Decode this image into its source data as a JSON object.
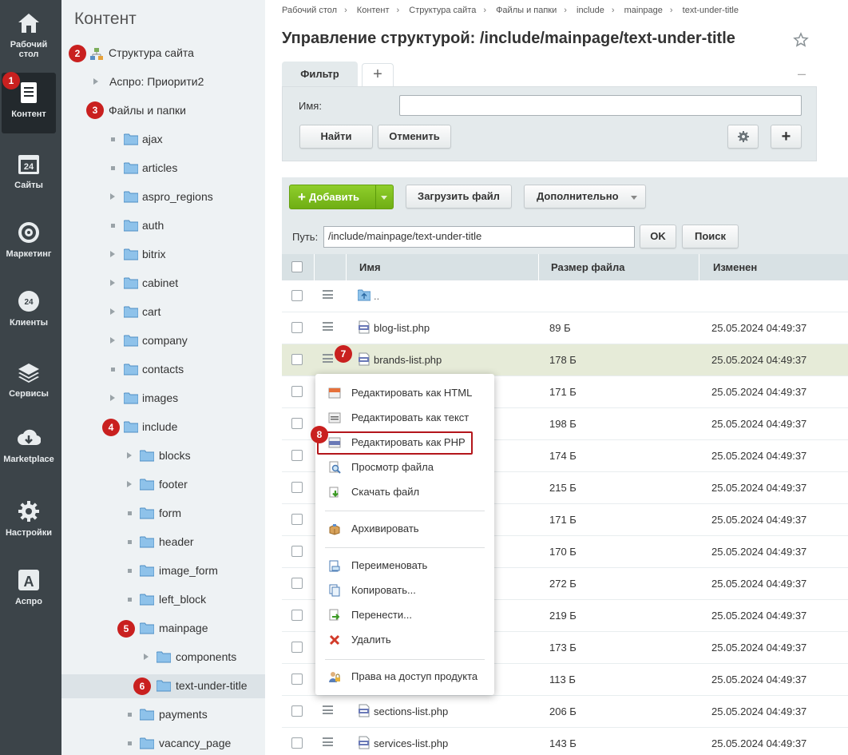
{
  "nav": {
    "items": [
      {
        "label": "Рабочий стол",
        "icon": "desktop-icon"
      },
      {
        "label": "Контент",
        "icon": "document-icon"
      },
      {
        "label": "Сайты",
        "icon": "calendar-24-icon"
      },
      {
        "label": "Маркетинг",
        "icon": "target-icon"
      },
      {
        "label": "Клиенты",
        "icon": "clients-24-icon"
      },
      {
        "label": "Сервисы",
        "icon": "layers-icon"
      },
      {
        "label": "Marketplace",
        "icon": "cloud-download-icon"
      },
      {
        "label": "Настройки",
        "icon": "gear-icon"
      },
      {
        "label": "Аспро",
        "icon": "letter-a-icon"
      }
    ]
  },
  "menu": {
    "title": "Контент",
    "tree": [
      {
        "label": "Структура сайта"
      },
      {
        "label": "Аспро: Приорити2"
      },
      {
        "label": "Файлы и папки"
      },
      {
        "label": "ajax"
      },
      {
        "label": "articles"
      },
      {
        "label": "aspro_regions"
      },
      {
        "label": "auth"
      },
      {
        "label": "bitrix"
      },
      {
        "label": "cabinet"
      },
      {
        "label": "cart"
      },
      {
        "label": "company"
      },
      {
        "label": "contacts"
      },
      {
        "label": "images"
      },
      {
        "label": "include"
      },
      {
        "label": "blocks"
      },
      {
        "label": "footer"
      },
      {
        "label": "form"
      },
      {
        "label": "header"
      },
      {
        "label": "image_form"
      },
      {
        "label": "left_block"
      },
      {
        "label": "mainpage"
      },
      {
        "label": "components"
      },
      {
        "label": "text-under-title"
      },
      {
        "label": "payments"
      },
      {
        "label": "vacancy_page"
      }
    ]
  },
  "badges": [
    "1",
    "2",
    "3",
    "4",
    "5",
    "6",
    "7",
    "8"
  ],
  "breadcrumb": [
    "Рабочий стол",
    "Контент",
    "Структура сайта",
    "Файлы и папки",
    "include",
    "mainpage",
    "text-under-title"
  ],
  "page": {
    "title": "Управление структурой: /include/mainpage/text-under-title"
  },
  "filter": {
    "tab_label": "Фильтр",
    "add_tab": "+",
    "minimize": "–",
    "name_label": "Имя:",
    "name_value": "",
    "find_label": "Найти",
    "cancel_label": "Отменить",
    "add_label": "+"
  },
  "toolbar": {
    "add_label": "Добавить",
    "upload_label": "Загрузить файл",
    "more_label": "Дополнительно",
    "path_label": "Путь:",
    "path_value": "/include/mainpage/text-under-title",
    "ok_label": "OK",
    "search_label": "Поиск"
  },
  "table": {
    "columns": [
      "Имя",
      "Размер файла",
      "Изменен"
    ],
    "rows": [
      {
        "name": "..",
        "size": "",
        "date": ""
      },
      {
        "name": "blog-list.php",
        "size": "89 Б",
        "date": "25.05.2024 04:49:37"
      },
      {
        "name": "brands-list.php",
        "size": "178 Б",
        "date": "25.05.2024 04:49:37"
      },
      {
        "name": "",
        "size": "171 Б",
        "date": "25.05.2024 04:49:37"
      },
      {
        "name": "",
        "size": "198 Б",
        "date": "25.05.2024 04:49:37"
      },
      {
        "name": "",
        "size": "174 Б",
        "date": "25.05.2024 04:49:37"
      },
      {
        "name": "",
        "size": "215 Б",
        "date": "25.05.2024 04:49:37"
      },
      {
        "name": "",
        "size": "171 Б",
        "date": "25.05.2024 04:49:37"
      },
      {
        "name": "",
        "size": "170 Б",
        "date": "25.05.2024 04:49:37"
      },
      {
        "name": "",
        "size": "272 Б",
        "date": "25.05.2024 04:49:37"
      },
      {
        "name": "",
        "size": "219 Б",
        "date": "25.05.2024 04:49:37"
      },
      {
        "name": "",
        "size": "173 Б",
        "date": "25.05.2024 04:49:37"
      },
      {
        "name": "",
        "size": "113 Б",
        "date": "25.05.2024 04:49:37"
      },
      {
        "name": "sections-list.php",
        "size": "206 Б",
        "date": "25.05.2024 04:49:37"
      },
      {
        "name": "services-list.php",
        "size": "143 Б",
        "date": "25.05.2024 04:49:37"
      }
    ]
  },
  "context_menu": {
    "items": [
      {
        "label": "Редактировать как HTML"
      },
      {
        "label": "Редактировать как текст"
      },
      {
        "label": "Редактировать как PHP"
      },
      {
        "label": "Просмотр файла"
      },
      {
        "label": "Скачать файл"
      },
      {
        "label": "Архивировать"
      },
      {
        "label": "Переименовать"
      },
      {
        "label": "Копировать..."
      },
      {
        "label": "Перенести..."
      },
      {
        "label": "Удалить"
      },
      {
        "label": "Права на доступ продукта"
      }
    ]
  },
  "colors": {
    "accent_green": "#7cbd1d",
    "badge_red": "#c9201f",
    "nav_dark": "#3c4449"
  }
}
